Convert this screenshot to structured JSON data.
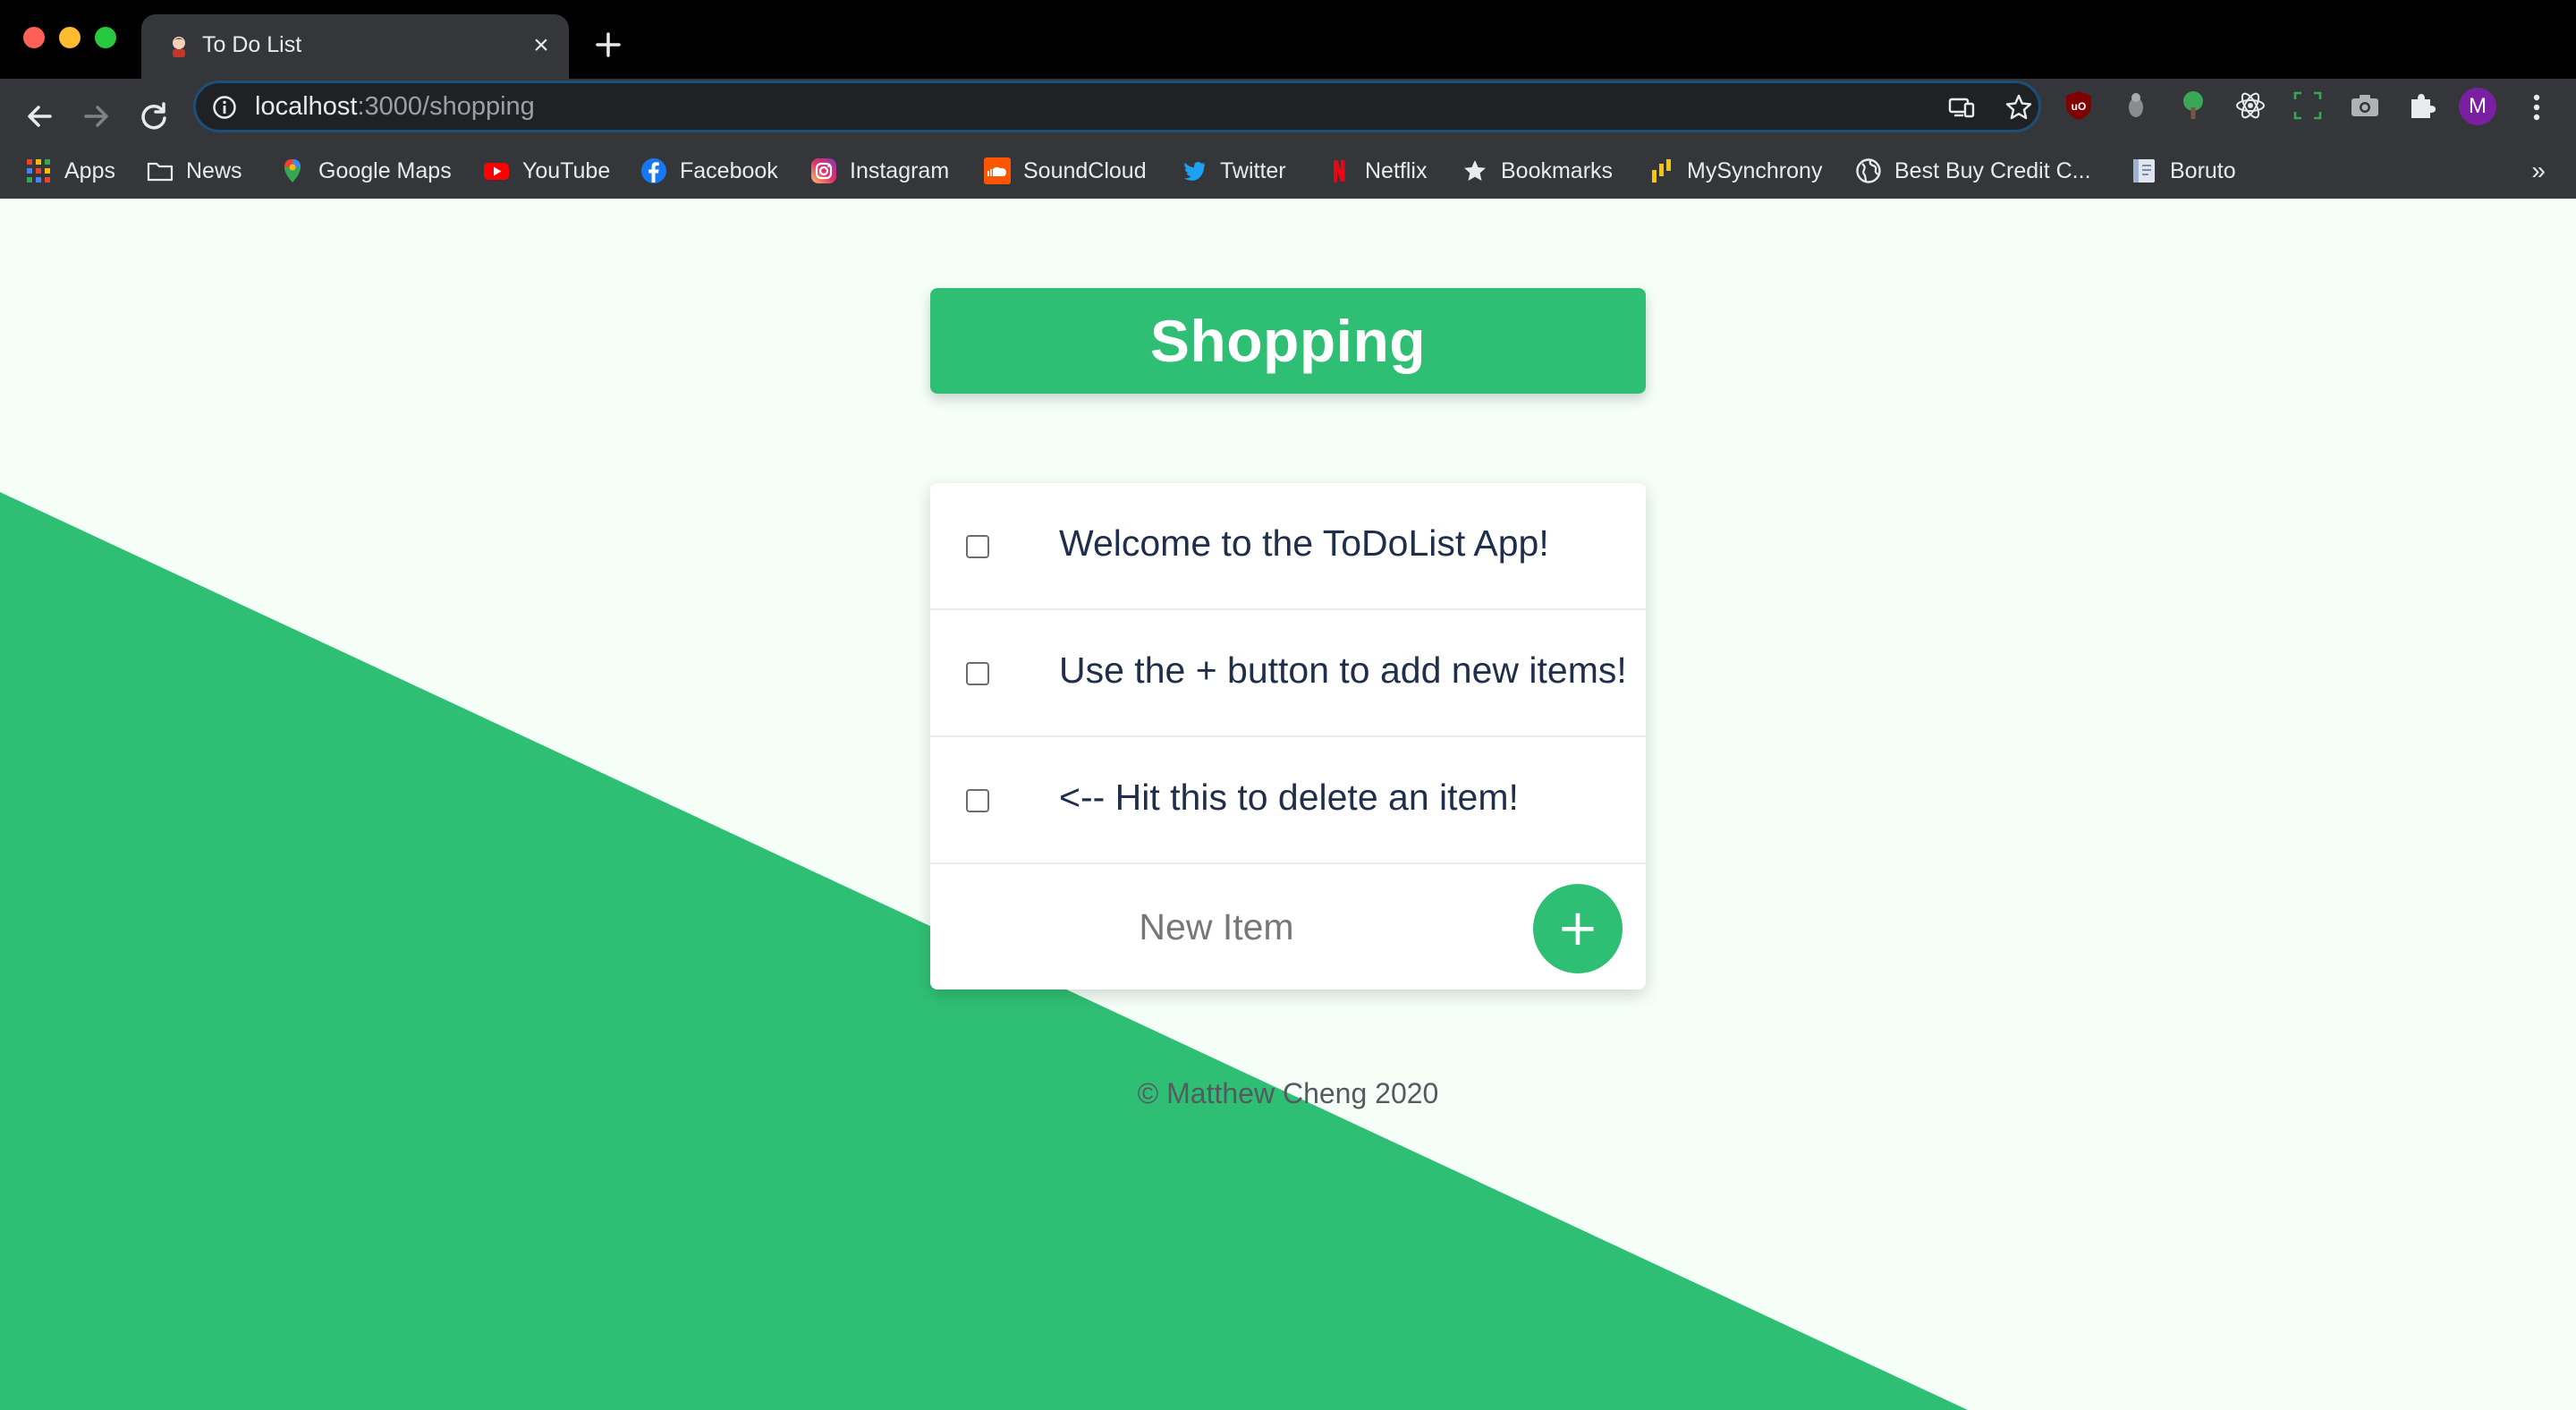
{
  "browser": {
    "tab": {
      "title": "To Do List"
    },
    "address": {
      "host": "localhost",
      "path": ":3000/shopping"
    },
    "bookmarks": [
      {
        "label": "Apps",
        "icon": "apps-grid-icon"
      },
      {
        "label": "News",
        "icon": "folder-icon"
      },
      {
        "label": "Google Maps",
        "icon": "google-maps-icon"
      },
      {
        "label": "YouTube",
        "icon": "youtube-icon"
      },
      {
        "label": "Facebook",
        "icon": "facebook-icon"
      },
      {
        "label": "Instagram",
        "icon": "instagram-icon"
      },
      {
        "label": "SoundCloud",
        "icon": "soundcloud-icon"
      },
      {
        "label": "Twitter",
        "icon": "twitter-icon"
      },
      {
        "label": "Netflix",
        "icon": "netflix-icon"
      },
      {
        "label": "Bookmarks",
        "icon": "star-icon"
      },
      {
        "label": "MySynchrony",
        "icon": "mysynchrony-icon"
      },
      {
        "label": "Best Buy Credit C...",
        "icon": "globe-icon"
      },
      {
        "label": "Boruto",
        "icon": "book-icon"
      }
    ],
    "bookmarks_more": "»",
    "profile_initial": "M"
  },
  "page": {
    "list_title": "Shopping",
    "items": [
      {
        "text": "Welcome to the ToDoList App!",
        "checked": false
      },
      {
        "text": "Use the + button to add new items!",
        "checked": false
      },
      {
        "text": "<-- Hit this to delete an item!",
        "checked": false
      }
    ],
    "new_item_placeholder": "New Item",
    "add_button_label": "+",
    "footer": "© Matthew Cheng 2020"
  },
  "colors": {
    "accent": "#2fbf74",
    "page_background": "#f5fff8",
    "item_text": "#1f2f4a"
  }
}
